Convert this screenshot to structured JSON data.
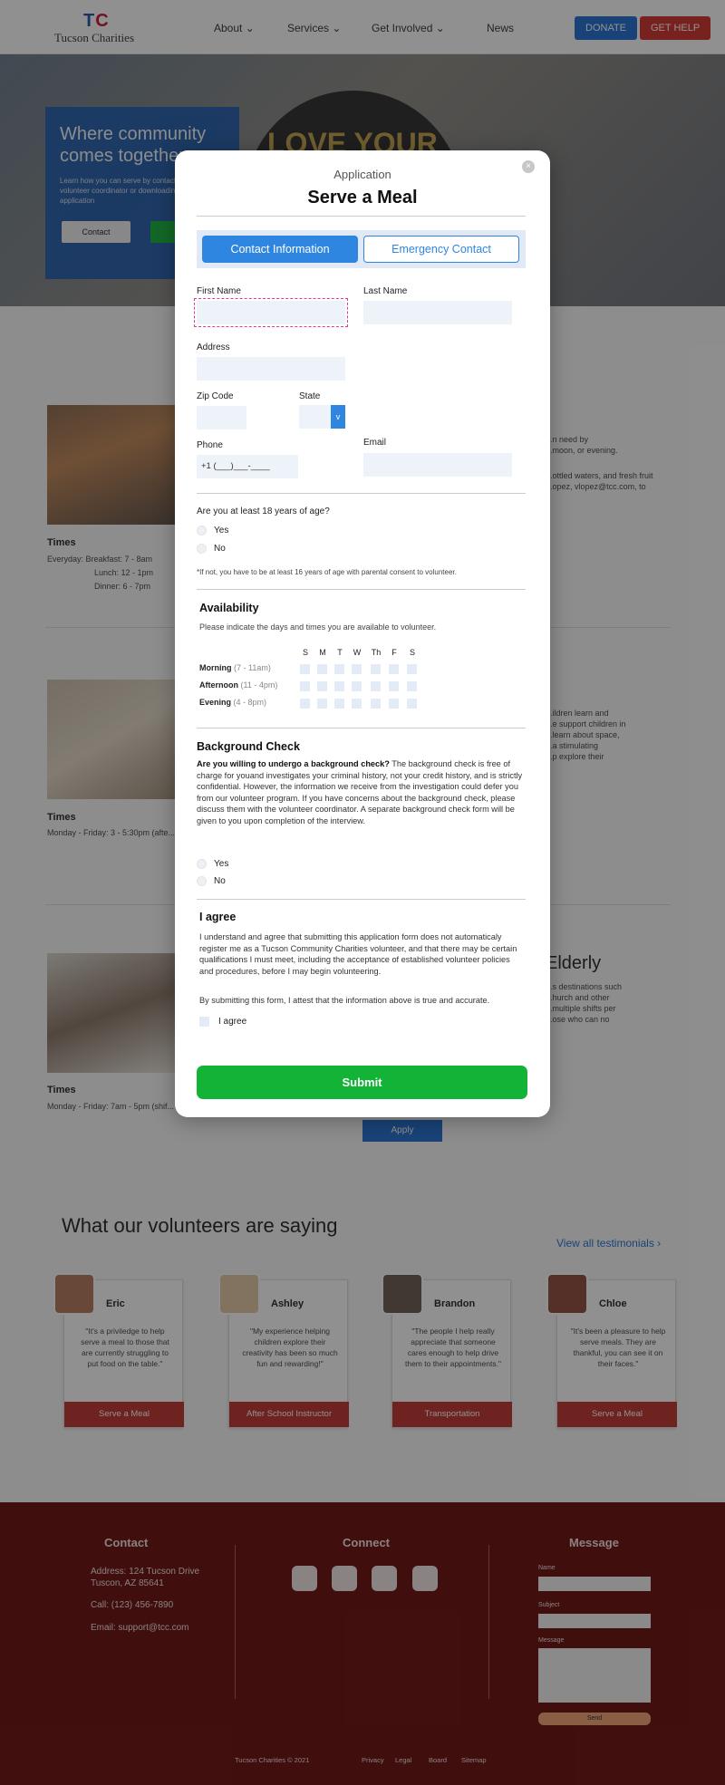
{
  "site": {
    "logo_mark_t": "T",
    "logo_mark_c": "C",
    "logo_text": "Tucson Charities",
    "nav": [
      "About ⌄",
      "Services ⌄",
      "Get Involved ⌄",
      "News"
    ],
    "donate": "DONATE",
    "get_help": "GET HELP"
  },
  "hero": {
    "title": "Where community comes together",
    "text": "Learn how you can serve by contacting our volunteer coordinator or downloading our volunteer application",
    "contact_btn": "Contact",
    "cap_text": "LOVE YOUR"
  },
  "background": {
    "meal_times_h": "Times",
    "meal_times_1": "Everyday:     Breakfast: 7 - 8am",
    "meal_times_2": "Lunch: 12 - 1pm",
    "meal_times_3": "Dinner: 6 - 7pm",
    "meal_right_1": "...n need by",
    "meal_right_2": "...moon, or evening.",
    "meal_right_3": "...ottled waters, and fresh fruit",
    "meal_right_4": "...opez, vlopez@tcc.com, to",
    "school_times_h": "Times",
    "school_times": "Monday - Friday: 3 - 5:30pm (afte...",
    "school_right_1": "...ildren learn and",
    "school_right_2": "...e support children in",
    "school_right_3": "...learn about space,",
    "school_right_4": "...a stimulating",
    "school_right_5": "...p explore their",
    "elderly_title": "Elderly",
    "elderly_right_1": "...s destinations such",
    "elderly_right_2": "...hurch and other",
    "elderly_right_3": "...multiple shifts per",
    "elderly_right_4": "...ose who can no",
    "trans_times_h": "Times",
    "trans_times": "Monday - Friday: 7am - 5pm (shif...",
    "apply": "Apply"
  },
  "testimonials": {
    "heading": "What our volunteers are saying",
    "view_all": "View all testimonials  ›",
    "cards": [
      {
        "name": "Eric",
        "quote": "\"It's a priviledge to help serve a meal to those that are currently struggling to put food on the table.\"",
        "role": "Serve a Meal"
      },
      {
        "name": "Ashley",
        "quote": "\"My experience helping children explore their creativity has been so much fun and rewarding!\"",
        "role": "After School Instructor"
      },
      {
        "name": "Brandon",
        "quote": "\"The people I help really appreciate that someone cares enough to help drive them to their appointments.\"",
        "role": "Transportation"
      },
      {
        "name": "Chloe",
        "quote": "\"It's been a pleasure to help serve meals. They are thankful, you can see it on their faces.\"",
        "role": "Serve a Meal"
      }
    ]
  },
  "footer": {
    "contact_h": "Contact",
    "address_1": "Address: 124 Tucson Drive",
    "address_2": "Tuscon, AZ 85641",
    "call": "Call: (123) 456-7890",
    "email": "Email: support@tcc.com",
    "connect_h": "Connect",
    "message_h": "Message",
    "name_lbl": "Name",
    "subject_lbl": "Subject",
    "message_lbl": "Message",
    "send": "Send",
    "copyright": "Tucson Charities © 2021",
    "links": [
      "Privacy",
      "Legal",
      "Board",
      "Sitemap"
    ],
    "social_icons": [
      "facebook-icon",
      "instagram-icon",
      "linkedin-icon",
      "twitter-icon"
    ]
  },
  "modal": {
    "close": "×",
    "subtitle": "Application",
    "title": "Serve a Meal",
    "tab_contact": "Contact Information",
    "tab_emergency": "Emergency Contact",
    "first_name_lbl": "First Name",
    "last_name_lbl": "Last Name",
    "address_lbl": "Address",
    "zip_lbl": "Zip Code",
    "state_lbl": "State",
    "state_caret": "v",
    "phone_lbl": "Phone",
    "phone_value": "+1 (___)___-____",
    "email_lbl": "Email",
    "age_q": "Are you at least 18 years of age?",
    "yes": "Yes",
    "no": "No",
    "age_note": "*If not, you have to be at least 16 years of age with parental consent to volunteer.",
    "availability_h": "Availability",
    "availability_p": "Please indicate the days and times you are available to volunteer.",
    "days": [
      "S",
      "M",
      "T",
      "W",
      "Th",
      "F",
      "S"
    ],
    "slots": [
      {
        "label": "Morning",
        "time": "(7 - 11am)"
      },
      {
        "label": "Afternoon",
        "time": "(11 - 4pm)"
      },
      {
        "label": "Evening",
        "time": "(4 - 8pm)"
      }
    ],
    "bg_h": "Background Check",
    "bg_bold": "Are you willing to undergo a background check?",
    "bg_text": " The background check is free of charge for youand investigates your criminal history, not your credit history, and is strictly confidential. However, the information we receive from the investigation could defer you from our volunteer program. If you have concerns about the background check, please discuss them with the volunteer coordinator. A separate background check form will be given to you upon completion of the interview.",
    "agree_h": "I agree",
    "agree_text": "I understand and agree that submitting this application form does not automaticaly register me as a Tucson Community Charities volunteer, and that there may be certain qualifications I must meet, including the acceptance of established volunteer policies and procedures, before I may begin volunteering.",
    "attest": "By submitting this form, I attest that the information above is true and accurate.",
    "agree_cb": "I agree",
    "submit": "Submit"
  },
  "colors": {
    "primary": "#2f86e1",
    "submit": "#13b337",
    "footer": "#6b0a0a",
    "role_badge": "#c0322e"
  }
}
